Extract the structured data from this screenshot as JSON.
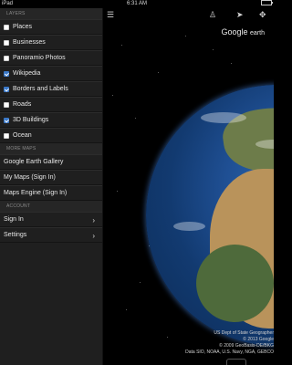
{
  "status_bar": {
    "carrier": "iPad",
    "time": "6:31 AM",
    "battery_level": 1.0
  },
  "sidebar": {
    "layers_header": "LAYERS",
    "layers": [
      {
        "label": "Places",
        "checked": false
      },
      {
        "label": "Businesses",
        "checked": false
      },
      {
        "label": "Panoramio Photos",
        "checked": false
      },
      {
        "label": "Wikipedia",
        "checked": true
      },
      {
        "label": "Borders and Labels",
        "checked": true
      },
      {
        "label": "Roads",
        "checked": false
      },
      {
        "label": "3D Buildings",
        "checked": true
      },
      {
        "label": "Ocean",
        "checked": false
      }
    ],
    "more_maps_header": "MORE MAPS",
    "more_maps": [
      {
        "label": "Google Earth Gallery"
      },
      {
        "label": "My Maps (Sign In)"
      },
      {
        "label": "Maps Engine (Sign In)"
      }
    ],
    "account_header": "ACCOUNT",
    "account": [
      {
        "label": "Sign In"
      },
      {
        "label": "Settings"
      }
    ]
  },
  "map": {
    "logo_main": "Google",
    "logo_sub": "earth",
    "copyright_lines": [
      "US Dept of State Geographer",
      "© 2013 Google",
      "© 2009 GeoBasis-DE/BKG",
      "Data SIO, NOAA, U.S. Navy, NGA, GEBCO"
    ]
  },
  "icons": {
    "menu": "menu-icon",
    "person": "pegman-icon",
    "location": "location-arrow-icon",
    "tour": "tour-icon"
  }
}
